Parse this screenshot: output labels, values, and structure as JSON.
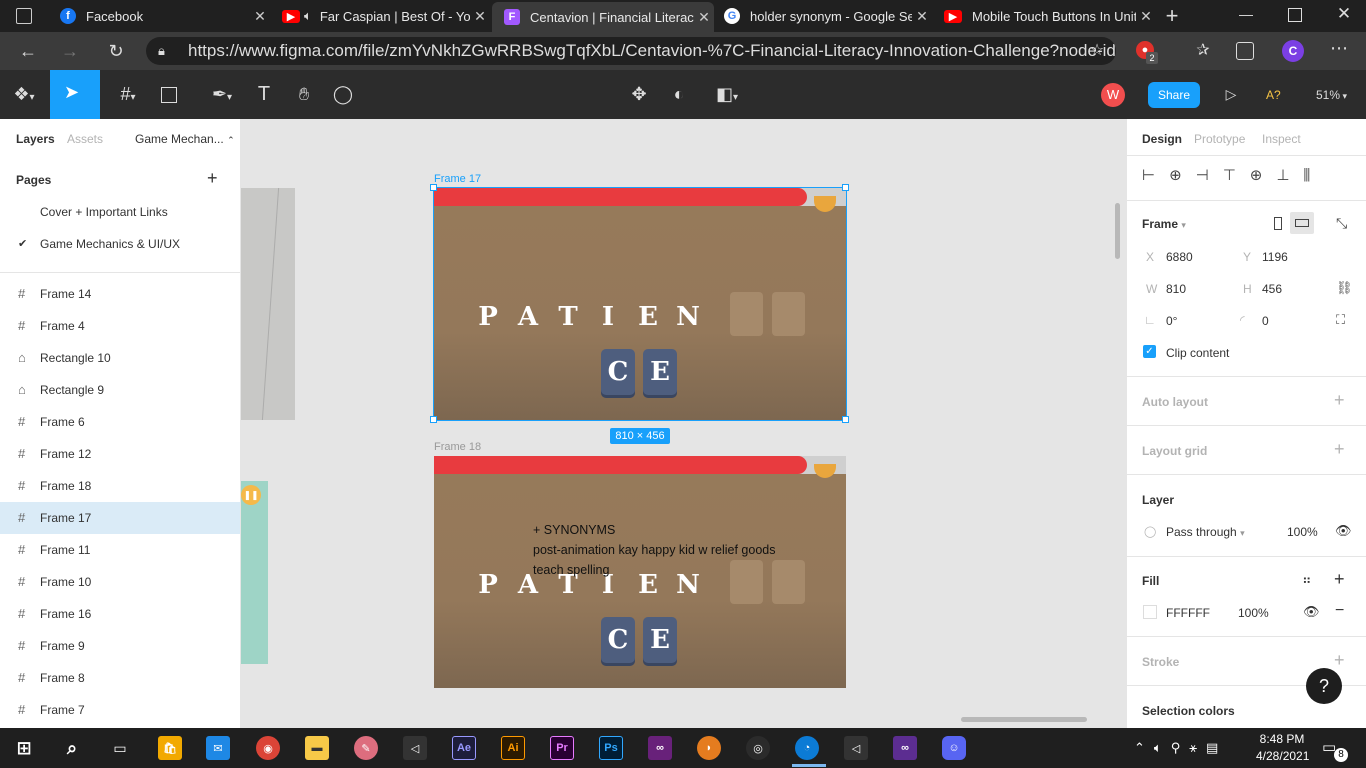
{
  "browser": {
    "tabs": [
      {
        "title": "Facebook",
        "icon": "facebook-icon",
        "color": "#1877f2"
      },
      {
        "title": "Far Caspian | Best Of - Yo",
        "icon": "youtube-icon",
        "color": "#ff0000"
      },
      {
        "title": "Centavion | Financial Literacy",
        "icon": "figma-icon",
        "color": "#a259ff"
      },
      {
        "title": "holder synonym - Google Sea",
        "icon": "google-icon",
        "color": "#4285f4"
      },
      {
        "title": "Mobile Touch Buttons In Unit",
        "icon": "youtube-icon",
        "color": "#ff0000"
      }
    ],
    "url": "https://www.figma.com/file/zmYvNkhZGwRRBSwgTqfXbL/Centavion-%7C-Financial-Literacy-Innovation-Challenge?node-id...",
    "ext_badge": "2",
    "profile": "C"
  },
  "toolbar": {
    "avatar": "W",
    "share": "Share",
    "zoom": "51%",
    "ai": "A?"
  },
  "left": {
    "tabs": [
      "Layers",
      "Assets"
    ],
    "page_title": "Game Mechan...",
    "pages_header": "Pages",
    "pages": [
      "Cover + Important Links",
      "Game Mechanics & UI/UX"
    ],
    "layers": [
      {
        "name": "Frame 14",
        "kind": "frame"
      },
      {
        "name": "Frame 4",
        "kind": "frame"
      },
      {
        "name": "Rectangle 10",
        "kind": "rect"
      },
      {
        "name": "Rectangle 9",
        "kind": "rect"
      },
      {
        "name": "Frame 6",
        "kind": "frame"
      },
      {
        "name": "Frame 12",
        "kind": "frame"
      },
      {
        "name": "Frame 18",
        "kind": "frame"
      },
      {
        "name": "Frame 17",
        "kind": "frame",
        "selected": true
      },
      {
        "name": "Frame 11",
        "kind": "frame"
      },
      {
        "name": "Frame 10",
        "kind": "frame"
      },
      {
        "name": "Frame 16",
        "kind": "frame"
      },
      {
        "name": "Frame 9",
        "kind": "frame"
      },
      {
        "name": "Frame 8",
        "kind": "frame"
      },
      {
        "name": "Frame 7",
        "kind": "frame"
      }
    ]
  },
  "canvas": {
    "frame17_label": "Frame 17",
    "frame18_label": "Frame 18",
    "size_badge": "810 × 456",
    "letters": [
      "P",
      "A",
      "T",
      "I",
      "E",
      "N"
    ],
    "tiles": [
      "C",
      "E"
    ],
    "note": [
      "+ SYNONYMS",
      "post-animation kay happy kid w relief goods",
      "teach spelling"
    ],
    "progress": 0.905
  },
  "right": {
    "tabs": [
      "Design",
      "Prototype",
      "Inspect"
    ],
    "frame_label": "Frame",
    "x_label": "X",
    "x": "6880",
    "y_label": "Y",
    "y": "1196",
    "w_label": "W",
    "w": "810",
    "h_label": "H",
    "h": "456",
    "rotation": "0°",
    "radius": "0",
    "clip": "Clip content",
    "auto_layout": "Auto layout",
    "layout_grid": "Layout grid",
    "layer": "Layer",
    "blend": "Pass through",
    "opacity": "100%",
    "fill": "Fill",
    "fill_hex": "FFFFFF",
    "fill_opacity": "100%",
    "stroke": "Stroke",
    "selection_colors": "Selection colors"
  },
  "taskbar": {
    "time": "8:48 PM",
    "date": "4/28/2021",
    "notif": "8"
  }
}
